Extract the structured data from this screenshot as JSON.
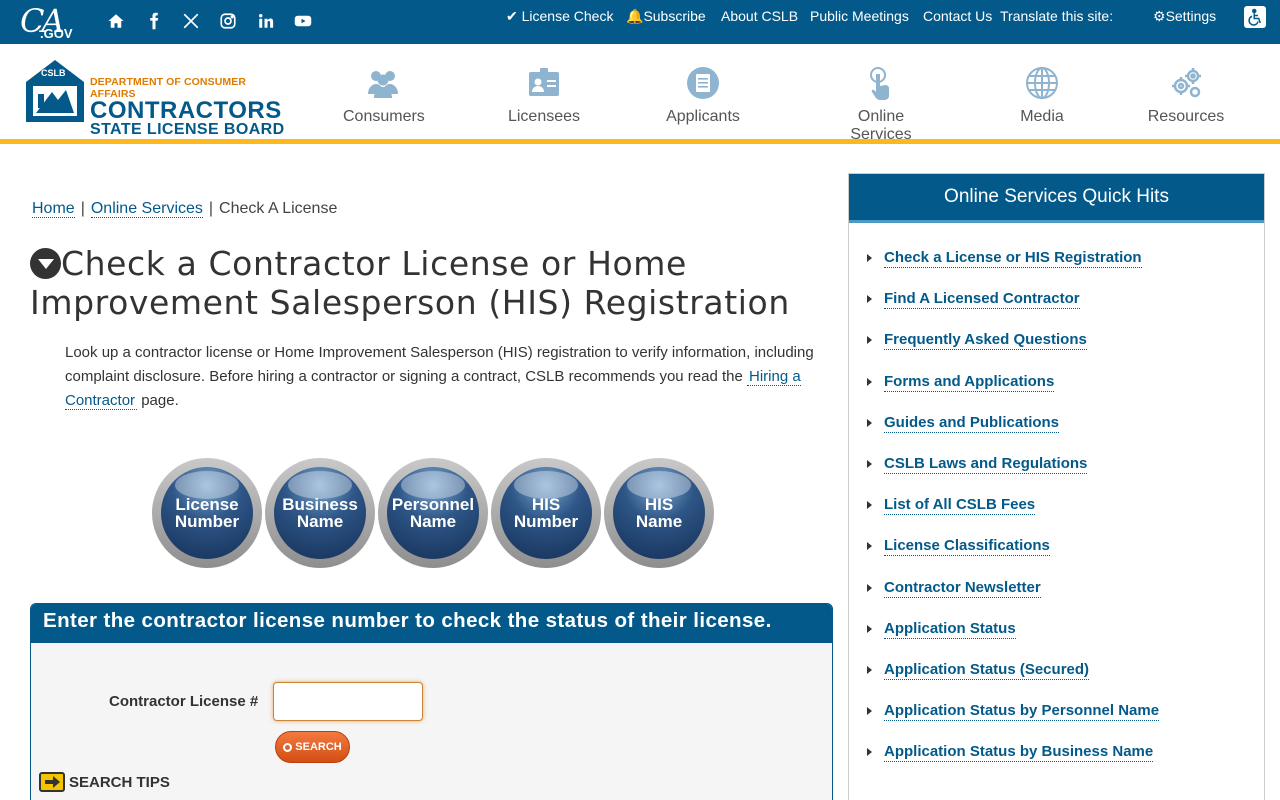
{
  "topbar": {
    "logo_main": "CA",
    "logo_sub": ".GOV",
    "links": {
      "license_check": "✔ License Check",
      "subscribe": "Subscribe",
      "about": "About CSLB",
      "meetings": "Public Meetings",
      "contact": "Contact Us",
      "translate": "Translate this site:",
      "settings": "Settings"
    }
  },
  "header": {
    "logo_dept": "DEPARTMENT OF CONSUMER AFFAIRS",
    "logo_line1": "CONTRACTORS",
    "logo_line2": "STATE LICENSE BOARD",
    "logo_badge": "CSLB",
    "nav": [
      "Consumers",
      "Licensees",
      "Applicants",
      "Online Services",
      "Media",
      "Resources"
    ]
  },
  "breadcrumb": {
    "home": "Home",
    "sep": "|",
    "online_services": "Online Services",
    "current": "Check A License"
  },
  "main": {
    "title": "Check a Contractor License or Home Improvement Salesperson (HIS) Registration",
    "intro_text": "Look up a contractor license or Home Improvement Salesperson (HIS) registration to verify information, including complaint disclosure. Before hiring a contractor or signing a contract, CSLB recommends you read the",
    "intro_link": "Hiring a Contractor",
    "intro_end": "page.",
    "search_buttons": [
      {
        "line1": "License",
        "line2": "Number"
      },
      {
        "line1": "Business",
        "line2": "Name"
      },
      {
        "line1": "Personnel",
        "line2": "Name"
      },
      {
        "line1": "HIS",
        "line2": "Number"
      },
      {
        "line1": "HIS",
        "line2": "Name"
      }
    ],
    "search_heading": "Enter the contractor license number to check the status of their license.",
    "search_label": "Contractor License #",
    "search_value": "",
    "search_button": "SEARCH",
    "search_tips": "SEARCH TIPS"
  },
  "sidebar": {
    "title": "Online Services Quick Hits",
    "links": [
      "Check a License or HIS Registration",
      "Find A Licensed Contractor",
      "Frequently Asked Questions",
      "Forms and Applications",
      "Guides and Publications",
      "CSLB Laws and Regulations",
      "List of All CSLB Fees",
      "License Classifications",
      "Contractor Newsletter",
      "Application Status",
      "Application Status (Secured)",
      "Application Status by Personnel Name",
      "Application Status by Business Name"
    ]
  },
  "colors": {
    "primary": "#035a8a",
    "accent": "#fdb81e",
    "search_button": "#e0621f"
  }
}
